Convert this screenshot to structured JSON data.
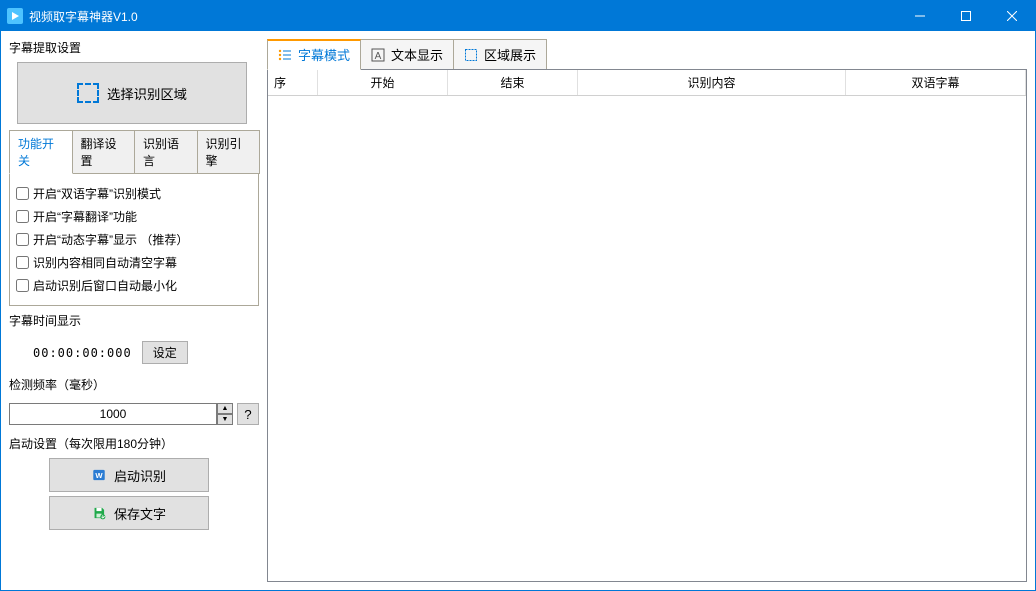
{
  "window": {
    "title": "视频取字幕神器V1.0"
  },
  "left": {
    "extract_label": "字幕提取设置",
    "select_area_btn": "选择识别区域",
    "settings_tabs": [
      "功能开关",
      "翻译设置",
      "识别语言",
      "识别引擎"
    ],
    "checkboxes": [
      "开启“双语字幕”识别模式",
      "开启“字幕翻译”功能",
      "开启“动态字幕”显示   （推荐）",
      "识别内容相同自动清空字幕",
      "启动识别后窗口自动最小化"
    ],
    "time_label": "字幕时间显示",
    "time_value": "00:00:00:000",
    "time_set_btn": "设定",
    "freq_label": "检测频率（毫秒）",
    "freq_value": "1000",
    "help_btn": "?",
    "startup_label": "启动设置（每次限用180分钟）",
    "start_btn": "启动识别",
    "save_btn": "保存文字"
  },
  "right": {
    "tabs": [
      "字幕模式",
      "文本显示",
      "区域展示"
    ],
    "columns": [
      "序",
      "开始",
      "结束",
      "识别内容",
      "双语字幕"
    ]
  }
}
